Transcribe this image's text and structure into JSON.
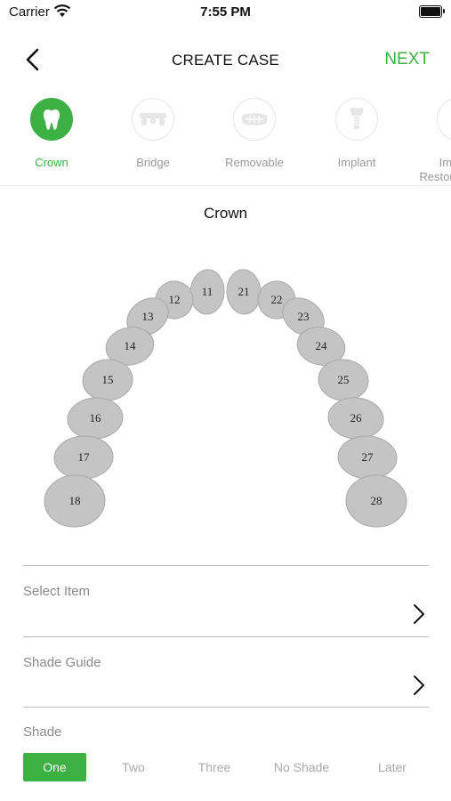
{
  "status_bar": {
    "carrier": "Carrier",
    "time": "7:55 PM"
  },
  "header": {
    "title": "CREATE CASE",
    "next_label": "NEXT"
  },
  "categories": [
    {
      "label": "Crown",
      "icon": "tooth-icon",
      "active": true
    },
    {
      "label": "Bridge",
      "icon": "bridge-icon",
      "active": false
    },
    {
      "label": "Removable",
      "icon": "removable-icon",
      "active": false
    },
    {
      "label": "Implant",
      "icon": "implant-icon",
      "active": false
    },
    {
      "label": "Implant Restoration T...",
      "icon": "implant-restoration-icon",
      "active": false
    }
  ],
  "section_title": "Crown",
  "teeth": [
    "11",
    "12",
    "13",
    "14",
    "15",
    "16",
    "17",
    "18",
    "21",
    "22",
    "23",
    "24",
    "25",
    "26",
    "27",
    "28"
  ],
  "form": {
    "select_item_label": "Select Item",
    "shade_guide_label": "Shade Guide",
    "shade_label": "Shade"
  },
  "shades": [
    "One",
    "Two",
    "Three",
    "No Shade",
    "Later"
  ],
  "selected_shade": "One",
  "colors": {
    "accent": "#3cb043",
    "tooth_fill": "#c4c4c4",
    "tooth_stroke": "#a9a9a9"
  }
}
